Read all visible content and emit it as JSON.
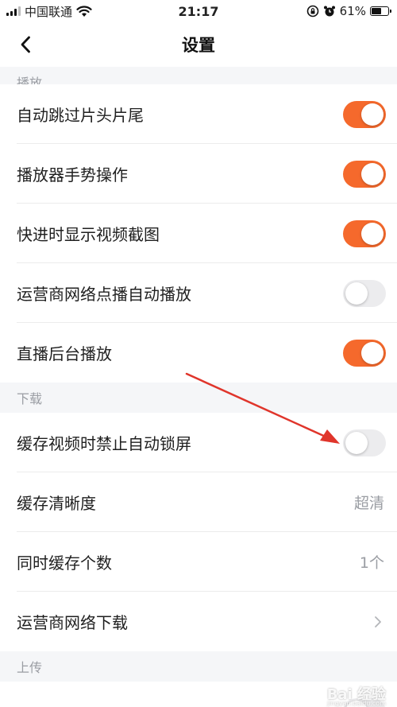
{
  "status_bar": {
    "carrier": "中国联通",
    "time": "21:17",
    "battery_percent": "61%",
    "battery_level": 0.61,
    "icons": [
      "signal-icon",
      "wifi-icon",
      "rotation-lock-icon",
      "alarm-icon",
      "battery-icon"
    ]
  },
  "nav": {
    "title": "设置",
    "back_icon": "chevron-left-icon"
  },
  "sections": {
    "playback": {
      "header": "播放",
      "items": [
        {
          "label": "自动跳过片头片尾",
          "toggle": true
        },
        {
          "label": "播放器手势操作",
          "toggle": true
        },
        {
          "label": "快进时显示视频截图",
          "toggle": true
        },
        {
          "label": "运营商网络点播自动播放",
          "toggle": false
        },
        {
          "label": "直播后台播放",
          "toggle": true
        }
      ]
    },
    "download": {
      "header": "下载",
      "items": [
        {
          "label": "缓存视频时禁止自动锁屏",
          "toggle": false
        },
        {
          "label": "缓存清晰度",
          "value": "超清"
        },
        {
          "label": "同时缓存个数",
          "value": "1个"
        },
        {
          "label": "运营商网络下载",
          "chevron": "chevron-right-icon"
        }
      ]
    },
    "upload": {
      "header": "上传"
    }
  },
  "annotation": {
    "arrow_color": "#e0352b"
  },
  "watermark": {
    "text": "Bai 经验",
    "sub": "jingyan.baidu.com"
  },
  "colors": {
    "toggle_on": "#f5692c",
    "toggle_off": "#ececee",
    "background": "#f5f6f8",
    "secondary_text": "#9a9da3"
  }
}
